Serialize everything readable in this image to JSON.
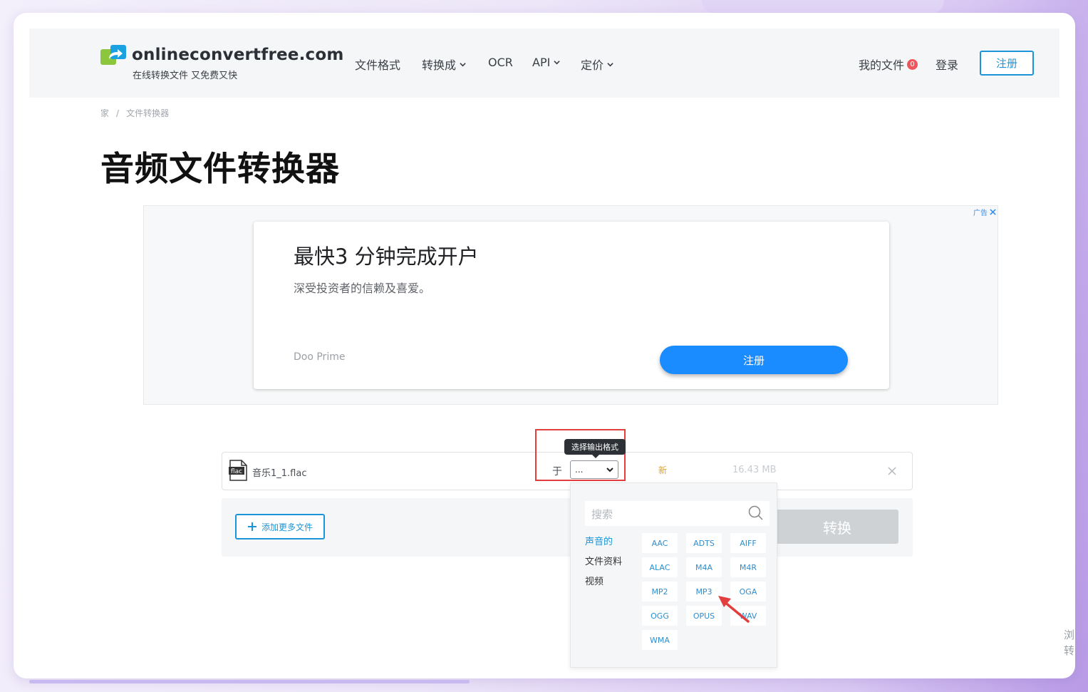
{
  "brand": {
    "name": "onlineconvertfree.com",
    "tagline": "在线转换文件 又免费又快"
  },
  "nav": {
    "file_formats": "文件格式",
    "convert_to": "转换成",
    "ocr": "OCR",
    "api": "API",
    "pricing": "定价",
    "my_files": "我的文件",
    "my_files_count": "0",
    "login": "登录",
    "signup": "注册"
  },
  "breadcrumb": {
    "home": "家",
    "separator": "/",
    "current": "文件转换器"
  },
  "page_title": "音频文件转换器",
  "ad": {
    "label": "广告",
    "headline": "最快3 分钟完成开户",
    "subtext": "深受投资者的信赖及喜爱。",
    "brand": "Doo Prime",
    "cta": "注册"
  },
  "file": {
    "type_label": "flac",
    "name": "音乐1_1.flac",
    "to_label": "于",
    "selected_format": "...",
    "status": "新",
    "size": "16.43 MB"
  },
  "tooltip": "选择输出格式",
  "actions": {
    "add_more": "添加更多文件",
    "convert": "转换"
  },
  "format_menu": {
    "search_placeholder": "搜索",
    "categories": [
      "声音的",
      "文件资料",
      "视频"
    ],
    "active_category": "声音的",
    "formats": [
      "AAC",
      "ADTS",
      "AIFF",
      "ALAC",
      "M4A",
      "M4R",
      "MP2",
      "MP3",
      "OGA",
      "OGG",
      "OPUS",
      "WAV",
      "WMA"
    ]
  },
  "side_text": "浏转",
  "colors": {
    "accent": "#1b95d8",
    "highlight": "#e23e3e",
    "status_new": "#e0a32c",
    "ad_cta": "#1a8cff"
  }
}
